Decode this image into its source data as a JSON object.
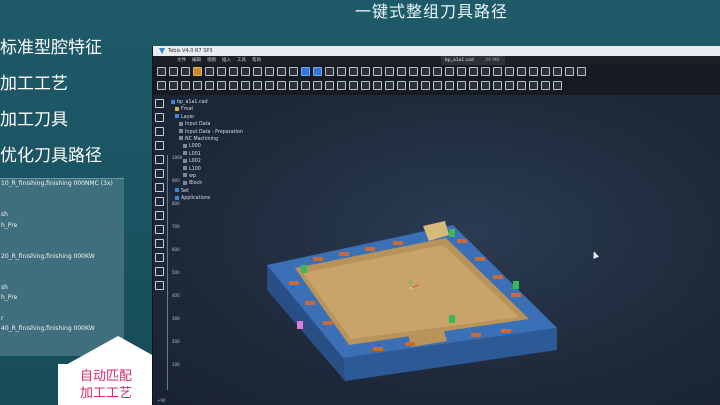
{
  "slide": {
    "title": "一键式整组刀具路径",
    "bullets": [
      {
        "label": "标准型腔特征"
      },
      {
        "label": "加工工艺"
      },
      {
        "label": "加工刀具"
      },
      {
        "label": "优化刀具路径"
      }
    ]
  },
  "operations_panel": {
    "lines": [
      "10_R_finishing,finishing 000NMC (3x)",
      "",
      "",
      "sh",
      "h_Pre",
      "",
      "",
      "20_R_finishing,finishing 000KW",
      "",
      "",
      "sh",
      "h_Pre",
      "",
      "r",
      "40_R_finishing,finishing 000KW",
      "",
      ""
    ]
  },
  "callout": {
    "line1": "自动匹配",
    "line2": "加工工艺"
  },
  "app": {
    "window_title": "Tebis V4.0 R7 SP3",
    "menu": [
      "文件",
      "编辑",
      "视图",
      "插入",
      "工具",
      "帮助"
    ],
    "document_tab": {
      "name": "bp_a1a1.cad",
      "size": "39 MB"
    },
    "tree": [
      {
        "label": "bp_a1a1.cad",
        "icon": "blue",
        "indent": 0
      },
      {
        "label": "Fmat",
        "icon": "yellow",
        "indent": 2
      },
      {
        "label": "Layer",
        "icon": "blue",
        "indent": 2
      },
      {
        "label": "Input Data",
        "icon": "grey",
        "indent": 4
      },
      {
        "label": "Input Data - Preparation",
        "icon": "grey",
        "indent": 4
      },
      {
        "label": "NC Machining",
        "icon": "grey",
        "indent": 4
      },
      {
        "label": "L000",
        "icon": "grey",
        "indent": 6
      },
      {
        "label": "L001",
        "icon": "grey",
        "indent": 6
      },
      {
        "label": "L002",
        "icon": "grey",
        "indent": 6
      },
      {
        "label": "L100",
        "icon": "grey",
        "indent": 6
      },
      {
        "label": "wp",
        "icon": "grey",
        "indent": 6
      },
      {
        "label": "Block",
        "icon": "grey",
        "indent": 6
      },
      {
        "label": "Set",
        "icon": "blue",
        "indent": 2
      },
      {
        "label": "Applications",
        "icon": "blue",
        "indent": 2
      }
    ],
    "ruler_ticks": [
      "1000",
      "900",
      "800",
      "700",
      "600",
      "500",
      "400",
      "300",
      "200",
      "100"
    ],
    "status_text": "+90",
    "colors": {
      "model_blue": "#3b6fb6",
      "floor_tan": "#c9a46a",
      "pad_orange": "#c96a3a",
      "insert_green": "#3bb75a",
      "accent_pink": "#e0246e"
    }
  }
}
